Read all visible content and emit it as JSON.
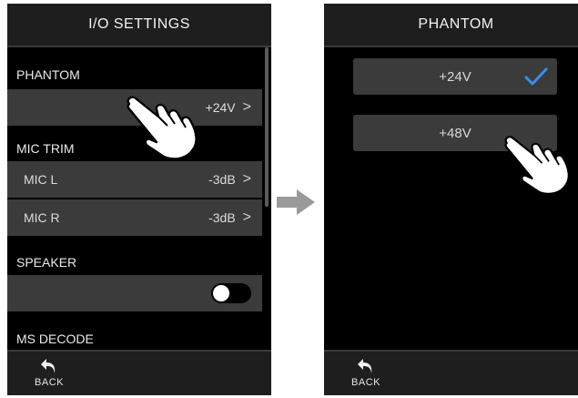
{
  "left_screen": {
    "title": "I/O SETTINGS",
    "phantom": {
      "label": "PHANTOM",
      "value": "+24V",
      "chevron": ">"
    },
    "mic_trim": {
      "label": "MIC TRIM",
      "rows": [
        {
          "name": "MIC L",
          "value": "-3dB",
          "chevron": ">"
        },
        {
          "name": "MIC R",
          "value": "-3dB",
          "chevron": ">"
        }
      ]
    },
    "speaker": {
      "label": "SPEAKER",
      "toggle_on": false
    },
    "ms_decode": {
      "label": "MS DECODE"
    },
    "back": {
      "label": "BACK",
      "icon": "back-arrow-icon"
    }
  },
  "right_screen": {
    "title": "PHANTOM",
    "options": [
      {
        "label": "+24V",
        "selected": true
      },
      {
        "label": "+48V",
        "selected": false
      }
    ],
    "back": {
      "label": "BACK",
      "icon": "back-arrow-icon"
    }
  },
  "colors": {
    "check": "#3a8ee6",
    "row_bg": "#3b3b3b",
    "bar_bg": "#1e1e1e",
    "arrow": "#9a9a9a"
  }
}
